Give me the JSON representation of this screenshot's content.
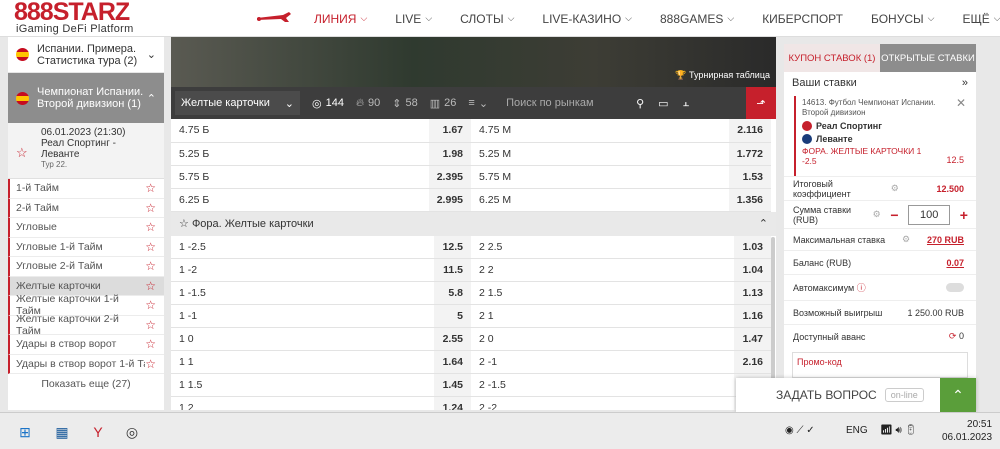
{
  "brand": {
    "name": "888STARZ",
    "tagline": "iGaming DeFi Platform"
  },
  "nav": [
    {
      "label": "ЛИНИЯ",
      "active": true
    },
    {
      "label": "LIVE"
    },
    {
      "label": "СЛОТЫ"
    },
    {
      "label": "LIVE-КАЗИНО"
    },
    {
      "label": "888GAMES"
    },
    {
      "label": "КИБЕРСПОРТ"
    },
    {
      "label": "БОНУСЫ"
    },
    {
      "label": "ЕЩЁ"
    }
  ],
  "sidebar": {
    "champ1": "Испании. Примера. Статистика тура (2)",
    "champ2": "Чемпионат Испании. Второй дивизион (1)",
    "match": {
      "date": "06.01.2023 (21:30)",
      "teams": "Реал Спортинг - Леванте",
      "tour": "Тур 22."
    },
    "markets": [
      "1-й Тайм",
      "2-й Тайм",
      "Угловые",
      "Угловые 1-й Тайм",
      "Угловые 2-й Тайм",
      "Желтые карточки",
      "Желтые карточки 1-й Тайм",
      "Желтые карточки 2-й Тайм",
      "Удары в створ ворот",
      "Удары в створ ворот 1-й Тайм"
    ],
    "show_more": "Показать еще (27)"
  },
  "center": {
    "tournament_table": "Турнирная таблица",
    "market_select": "Желтые карточки",
    "stats": [
      "144",
      "90",
      "58",
      "26"
    ],
    "search_placeholder": "Поиск по рынкам",
    "totals": [
      [
        "4.75 Б",
        "1.67",
        "4.75 М",
        "2.116"
      ],
      [
        "5.25 Б",
        "1.98",
        "5.25 М",
        "1.772"
      ],
      [
        "5.75 Б",
        "2.395",
        "5.75 М",
        "1.53"
      ],
      [
        "6.25 Б",
        "2.995",
        "6.25 М",
        "1.356"
      ]
    ],
    "section": "Фора. Желтые карточки",
    "handicap": [
      [
        "1 -2.5",
        "12.5",
        "2 2.5",
        "1.03"
      ],
      [
        "1 -2",
        "11.5",
        "2 2",
        "1.04"
      ],
      [
        "1 -1.5",
        "5.8",
        "2 1.5",
        "1.13"
      ],
      [
        "1 -1",
        "5",
        "2 1",
        "1.16"
      ],
      [
        "1 0",
        "2.55",
        "2 0",
        "1.47"
      ],
      [
        "1 1",
        "1.64",
        "2 -1",
        "2.16"
      ],
      [
        "1 1.5",
        "1.45",
        "2 -1.5",
        ""
      ],
      [
        "1 2",
        "1.24",
        "2 -2",
        ""
      ]
    ]
  },
  "betslip": {
    "tab1": "КУПОН СТАВОК (1)",
    "tab2": "ОТКРЫТЫЕ СТАВКИ",
    "your_bets": "Ваши ставки",
    "event": "14613. Футбол Чемпионат Испании. Второй дивизион",
    "team1": "Реал Спортинг",
    "team2": "Леванте",
    "market": "ФОРА. ЖЕЛТЫЕ КАРТОЧКИ 1 -2.5",
    "coef": "12.5",
    "total_label": "Итоговый коэффициент",
    "total": "12.500",
    "stake_label": "Сумма ставки (RUB)",
    "stake": "100",
    "max_label": "Максимальная ставка",
    "max": "270 RUB",
    "balance_label": "Баланс (RUB)",
    "balance": "0.07",
    "automax_label": "Автомаксимум",
    "win_label": "Возможный выигрыш",
    "win": "1 250.00 RUB",
    "advance_label": "Доступный аванс",
    "advance": "0",
    "promo_placeholder": "Промо-код"
  },
  "chat": {
    "label": "ЗАДАТЬ ВОПРОС",
    "status": "on-line"
  },
  "taskbar": {
    "lang": "ENG",
    "time": "20:51",
    "date": "06.01.2023"
  }
}
